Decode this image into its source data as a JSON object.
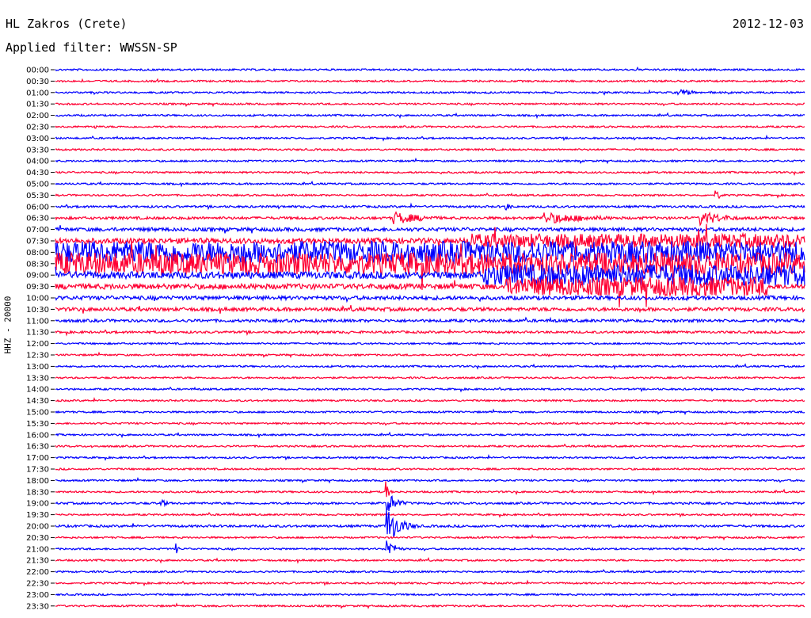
{
  "header": {
    "station": "HL Zakros (Crete)",
    "date": "2012-12-03",
    "filter": "Applied filter: WWSSN-SP"
  },
  "axis": {
    "channel_label": "HHZ - 20000"
  },
  "colors": {
    "trace_a": "#0000ff",
    "trace_b": "#ff0033"
  },
  "chart_data": {
    "type": "line",
    "title": "HL Zakros (Crete)",
    "subtitle": "Applied filter: WWSSN-SP",
    "ylabel": "HHZ - 20000",
    "xlabel": "",
    "row_labels": [
      "00:00",
      "00:30",
      "01:00",
      "01:30",
      "02:00",
      "02:30",
      "03:00",
      "03:30",
      "04:00",
      "04:30",
      "05:00",
      "05:30",
      "06:00",
      "06:30",
      "07:00",
      "07:30",
      "08:00",
      "08:30",
      "09:00",
      "09:30",
      "10:00",
      "10:30",
      "11:00",
      "11:30",
      "12:00",
      "12:30",
      "13:00",
      "13:30",
      "14:00",
      "14:30",
      "15:00",
      "15:30",
      "16:00",
      "16:30",
      "17:00",
      "17:30",
      "18:00",
      "18:30",
      "19:00",
      "19:30",
      "20:00",
      "20:30",
      "21:00",
      "21:30",
      "22:00",
      "22:30",
      "23:00",
      "23:30"
    ],
    "row_colors": [
      "trace_a",
      "trace_b"
    ],
    "row_noise_level": [
      1,
      1,
      1,
      1,
      1,
      1,
      1,
      1,
      1,
      1,
      1,
      1,
      1.2,
      1.5,
      2,
      3,
      5,
      5,
      4,
      3,
      2.2,
      2,
      1.6,
      1.3,
      1,
      1,
      1,
      1,
      1,
      1,
      1,
      1,
      1,
      1,
      1,
      1,
      1,
      1,
      1.2,
      1,
      1.3,
      1,
      1,
      1,
      1,
      1,
      1,
      1
    ],
    "events": [
      {
        "row": 2,
        "pos": 0.83,
        "amp": 6,
        "len": 0.06
      },
      {
        "row": 5,
        "pos": 0.05,
        "amp": 4,
        "len": 0.02
      },
      {
        "row": 11,
        "pos": 0.88,
        "amp": 9,
        "len": 0.02
      },
      {
        "row": 12,
        "pos": 0.6,
        "amp": 7,
        "len": 0.02
      },
      {
        "row": 13,
        "pos": 0.45,
        "amp": 9,
        "len": 0.12
      },
      {
        "row": 13,
        "pos": 0.65,
        "amp": 8,
        "len": 0.2
      },
      {
        "row": 13,
        "pos": 0.86,
        "amp": 10,
        "len": 0.1
      },
      {
        "row": 15,
        "pos": 0.55,
        "amp": 9,
        "len": 0.45
      },
      {
        "row": 16,
        "pos": 0.0,
        "amp": 14,
        "len": 1.0
      },
      {
        "row": 17,
        "pos": 0.0,
        "amp": 14,
        "len": 1.0
      },
      {
        "row": 18,
        "pos": 0.57,
        "amp": 14,
        "len": 0.43
      },
      {
        "row": 19,
        "pos": 0.6,
        "amp": 12,
        "len": 0.35
      },
      {
        "row": 37,
        "pos": 0.44,
        "amp": 22,
        "len": 0.01
      },
      {
        "row": 38,
        "pos": 0.14,
        "amp": 8,
        "len": 0.02
      },
      {
        "row": 38,
        "pos": 0.44,
        "amp": 18,
        "len": 0.04
      },
      {
        "row": 40,
        "pos": 0.44,
        "amp": 30,
        "len": 0.05
      },
      {
        "row": 42,
        "pos": 0.16,
        "amp": 9,
        "len": 0.01
      },
      {
        "row": 42,
        "pos": 0.44,
        "amp": 18,
        "len": 0.03
      },
      {
        "row": 42,
        "pos": 0.99,
        "amp": 7,
        "len": 0.01
      }
    ],
    "grid": false
  }
}
